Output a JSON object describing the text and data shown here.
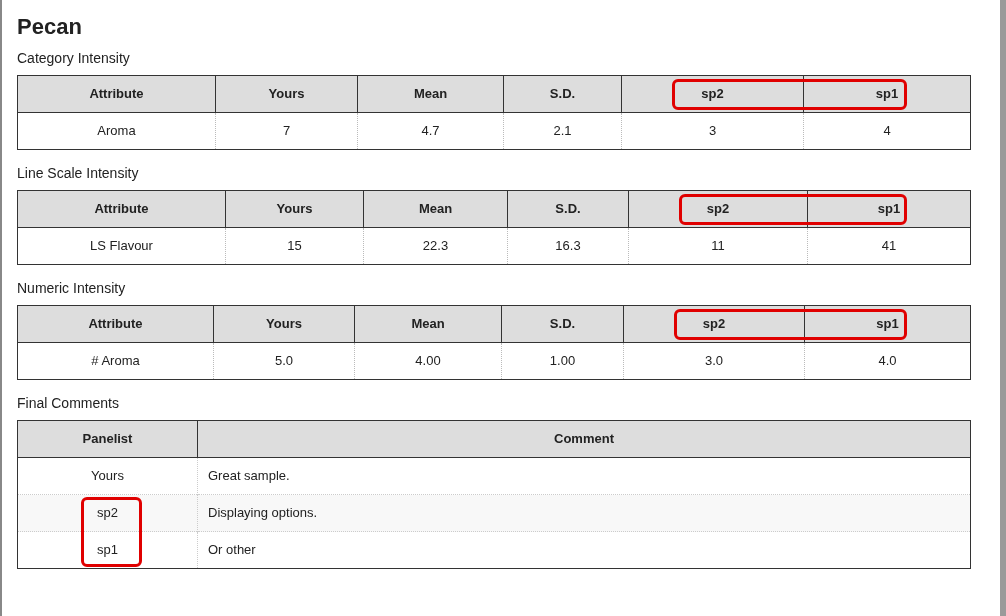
{
  "title": "Pecan",
  "tables": [
    {
      "heading": "Category Intensity",
      "columns": [
        {
          "label": "Attribute",
          "highlighted": false
        },
        {
          "label": "Yours",
          "highlighted": false
        },
        {
          "label": "Mean",
          "highlighted": false
        },
        {
          "label": "S.D.",
          "highlighted": false
        },
        {
          "label": "sp2",
          "highlighted": true
        },
        {
          "label": "sp1",
          "highlighted": true
        }
      ],
      "rows": [
        [
          "Aroma",
          "7",
          "4.7",
          "2.1",
          "3",
          "4"
        ]
      ]
    },
    {
      "heading": "Line Scale Intensity",
      "columns": [
        {
          "label": "Attribute",
          "highlighted": false
        },
        {
          "label": "Yours",
          "highlighted": false
        },
        {
          "label": "Mean",
          "highlighted": false
        },
        {
          "label": "S.D.",
          "highlighted": false
        },
        {
          "label": "sp2",
          "highlighted": true
        },
        {
          "label": "sp1",
          "highlighted": true
        }
      ],
      "rows": [
        [
          "LS Flavour",
          "15",
          "22.3",
          "16.3",
          "11",
          "41"
        ]
      ]
    },
    {
      "heading": "Numeric Intensity",
      "columns": [
        {
          "label": "Attribute",
          "highlighted": false
        },
        {
          "label": "Yours",
          "highlighted": false
        },
        {
          "label": "Mean",
          "highlighted": false
        },
        {
          "label": "S.D.",
          "highlighted": false
        },
        {
          "label": "sp2",
          "highlighted": true
        },
        {
          "label": "sp1",
          "highlighted": true
        }
      ],
      "rows": [
        [
          "# Aroma",
          "5.0",
          "4.00",
          "1.00",
          "3.0",
          "4.0"
        ]
      ]
    }
  ],
  "comments": {
    "heading": "Final Comments",
    "columns": [
      "Panelist",
      "Comment"
    ],
    "rows": [
      {
        "panelist": "Yours",
        "comment": "Great sample.",
        "highlighted": false
      },
      {
        "panelist": "sp2",
        "comment": "Displaying options.",
        "highlighted": true
      },
      {
        "panelist": "sp1",
        "comment": "Or other",
        "highlighted": true
      }
    ]
  }
}
